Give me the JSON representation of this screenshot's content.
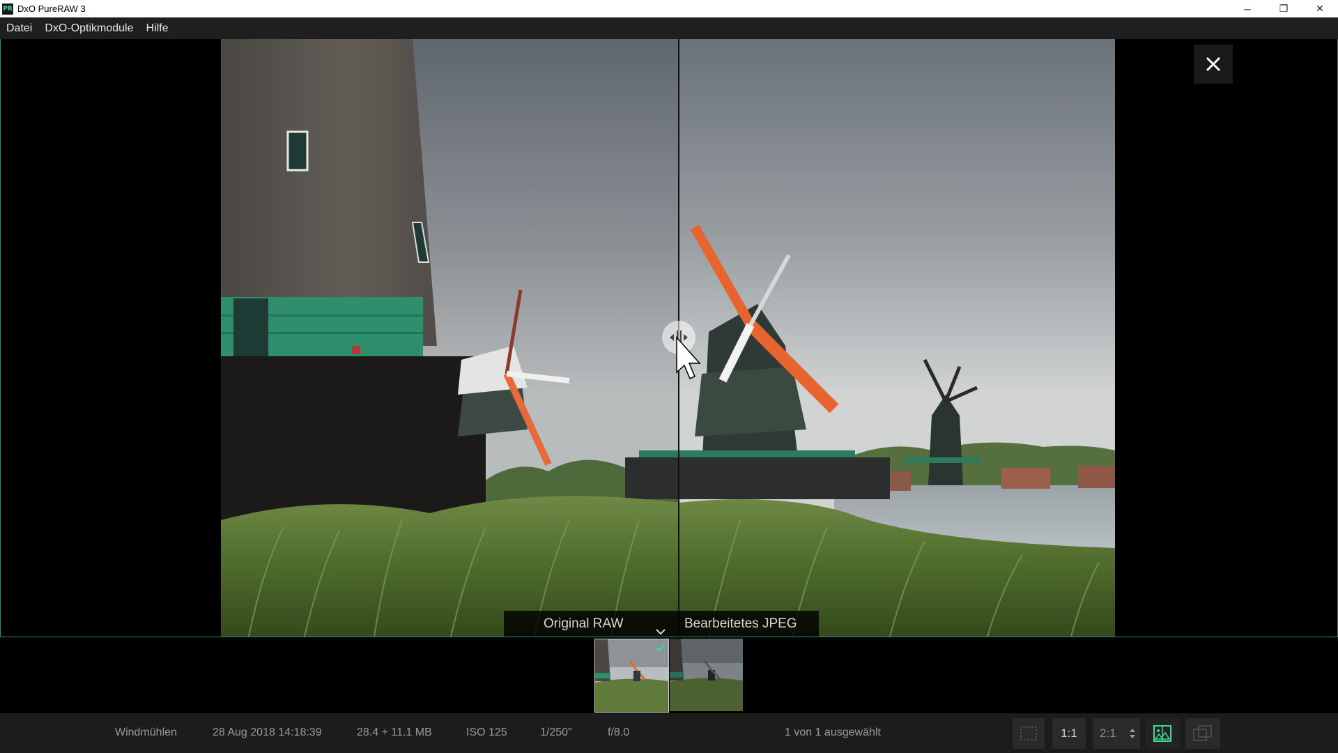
{
  "window": {
    "app_icon_label": "PR",
    "title": "DxO PureRAW 3",
    "controls": {
      "minimize": "─",
      "restore": "❐",
      "close": "✕"
    }
  },
  "menu": {
    "items": [
      "Datei",
      "DxO-Optikmodule",
      "Hilfe"
    ]
  },
  "viewer": {
    "close_icon": "close-icon",
    "compare": {
      "left_label": "Original RAW",
      "right_label": "Bearbeitetes JPEG"
    },
    "split_fraction": 0.417
  },
  "filmstrip": {
    "selected_index": 0
  },
  "status": {
    "name": "Windmühlen",
    "date": "28 Aug 2018 14:18:39",
    "size": "28.4 + 11.1 MB",
    "iso": "ISO 125",
    "shutter": "1/250\"",
    "aperture": "f/8.0",
    "selection": "1 von 1 ausgewählt",
    "zoom_1": "1:1",
    "zoom_2": "2:1"
  },
  "colors": {
    "accent": "#3ddc97",
    "border": "#2a8a7a",
    "menu_bg": "#1f1f1f",
    "status_bg": "#1c1c1c"
  }
}
